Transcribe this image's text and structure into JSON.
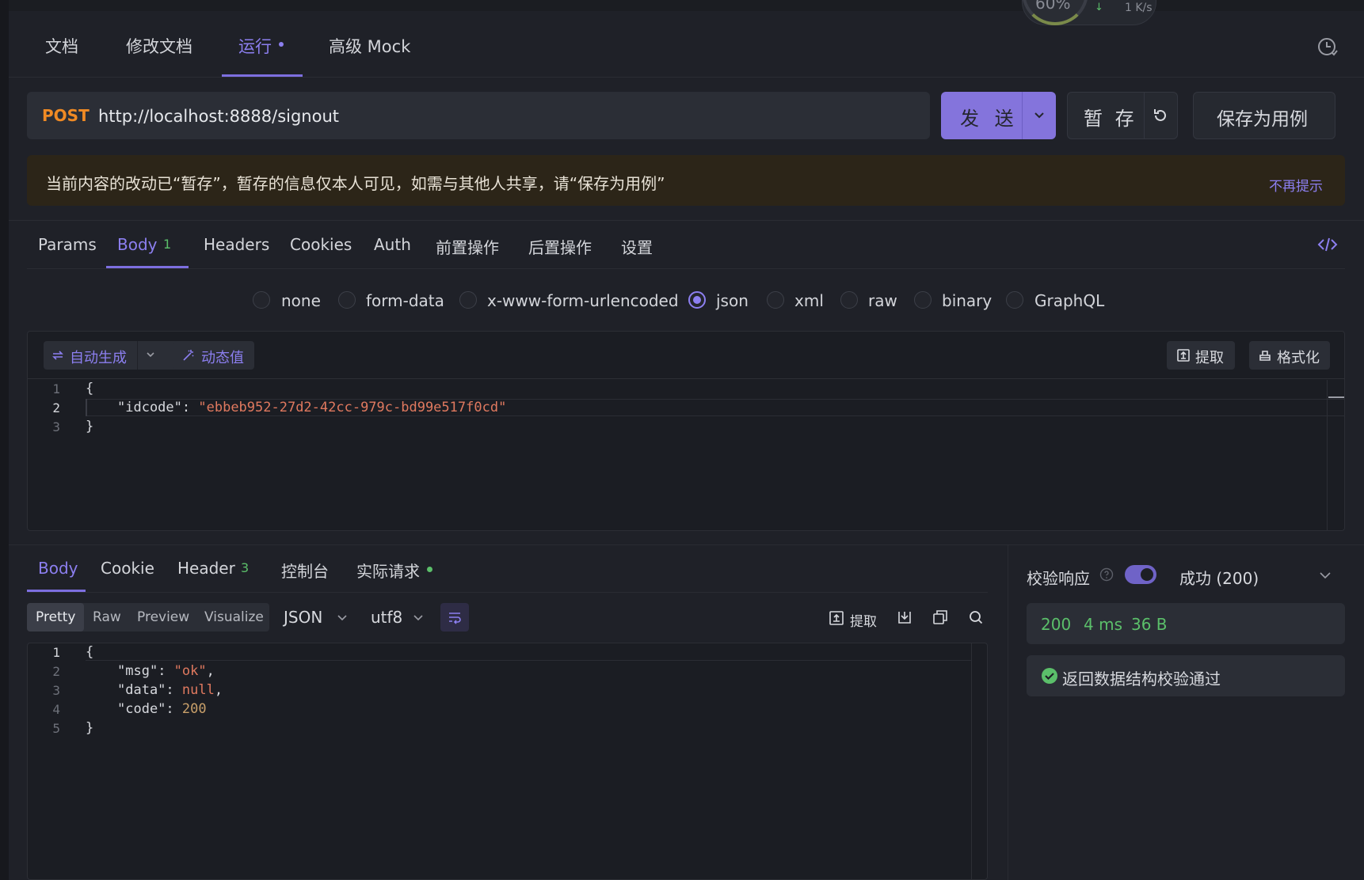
{
  "widget": {
    "gauge_text": "60%",
    "speed_arrow": "↓",
    "speed_text": "1 K/s"
  },
  "top_tabs": [
    {
      "label": "文档"
    },
    {
      "label": "修改文档"
    },
    {
      "label": "运行"
    },
    {
      "label": "高级 Mock"
    }
  ],
  "request": {
    "method": "POST",
    "url": "http://localhost:8888/signout",
    "send_label": "发 送",
    "stash_label": "暂 存",
    "save_case_label": "保存为用例"
  },
  "notice": {
    "text": "当前内容的改动已“暂存”，暂存的信息仅本人可见，如需与其他人共享，请“保存为用例”",
    "dismiss": "不再提示"
  },
  "request_tabs": [
    {
      "label": "Params"
    },
    {
      "label": "Body",
      "badge": "1"
    },
    {
      "label": "Headers"
    },
    {
      "label": "Cookies"
    },
    {
      "label": "Auth"
    },
    {
      "label": "前置操作"
    },
    {
      "label": "后置操作"
    },
    {
      "label": "设置"
    }
  ],
  "body_types": [
    {
      "label": "none",
      "selected": false
    },
    {
      "label": "form-data",
      "selected": false
    },
    {
      "label": "x-www-form-urlencoded",
      "selected": false
    },
    {
      "label": "json",
      "selected": true
    },
    {
      "label": "xml",
      "selected": false
    },
    {
      "label": "raw",
      "selected": false
    },
    {
      "label": "binary",
      "selected": false
    },
    {
      "label": "GraphQL",
      "selected": false
    }
  ],
  "editor_toolbar": {
    "autogen": "自动生成",
    "dynamic": "动态值",
    "extract": "提取",
    "format": "格式化"
  },
  "request_body": {
    "line_numbers": [
      "1",
      "2",
      "3"
    ],
    "lines": [
      {
        "open": "{"
      },
      {
        "key": "\"idcode\"",
        "colon": ": ",
        "value": "\"ebbeb952-27d2-42cc-979c-bd99e517f0cd\""
      },
      {
        "close": "}"
      }
    ]
  },
  "response_tabs": [
    {
      "label": "Body"
    },
    {
      "label": "Cookie"
    },
    {
      "label": "Header",
      "badge": "3"
    },
    {
      "label": "控制台"
    },
    {
      "label": "实际请求"
    }
  ],
  "response_view": {
    "modes": [
      "Pretty",
      "Raw",
      "Preview",
      "Visualize"
    ],
    "selected_mode": "Pretty",
    "language": "JSON",
    "encoding": "utf8",
    "extract": "提取"
  },
  "response_body": {
    "line_numbers": [
      "1",
      "2",
      "3",
      "4",
      "5"
    ],
    "open": "{",
    "msg_key": "\"msg\"",
    "msg_val": "\"ok\"",
    "data_key": "\"data\"",
    "data_val": "null",
    "code_key": "\"code\"",
    "code_val": "200",
    "close": "}",
    "comma": ",",
    "colon": ": "
  },
  "validation": {
    "label": "校验响应",
    "enabled": true,
    "status": "成功 (200)",
    "metrics": {
      "code": "200",
      "time": "4 ms",
      "size": "36 B"
    },
    "schema_result": "返回数据结构校验通过"
  },
  "colors": {
    "accent": "#8474dc",
    "method": "#f08a24",
    "success": "#5bbf6a",
    "string": "#e0795f",
    "notice_bg": "#2c2518"
  }
}
